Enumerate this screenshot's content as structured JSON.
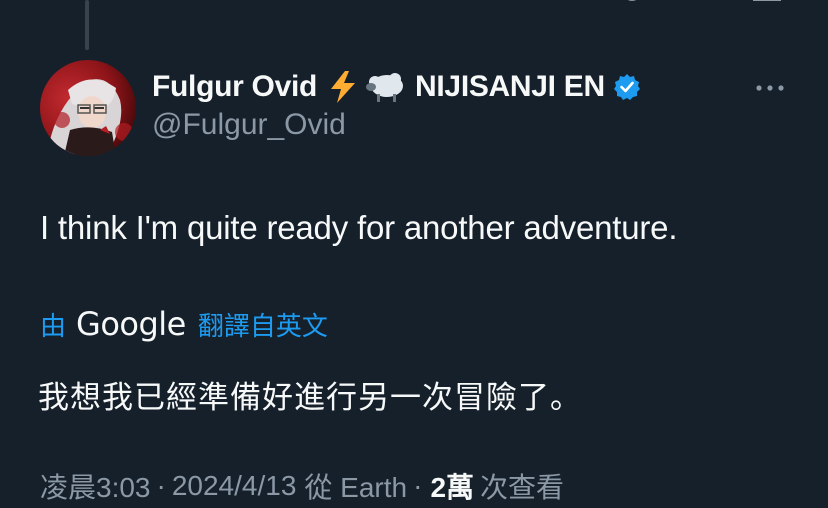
{
  "tweet": {
    "display_name": "Fulgur Ovid",
    "name_emojis": [
      "lightning-emoji",
      "sheep-emoji"
    ],
    "org": "NIJISANJI EN",
    "handle": "@Fulgur_Ovid",
    "text": "I think I'm quite ready for another adventure.",
    "translation": {
      "by_label": "由",
      "provider": "Google",
      "source_label": "翻譯自英文",
      "text": "我想我已經準備好進行另一次冒險了。"
    },
    "meta": {
      "time": "凌晨3:03",
      "separator": "·",
      "date": "2024/4/13",
      "source": "從 Earth",
      "views_count": "2萬",
      "views_label": "次查看"
    }
  },
  "colors": {
    "background": "#15202b",
    "accent": "#1d9bf0",
    "secondary_text": "#8b98a5",
    "verified": "#1d9bf0"
  },
  "icons": [
    "reply-icon",
    "retweet-icon",
    "like-icon",
    "views-icon",
    "bookmark-icon",
    "share-icon",
    "more-options-icon",
    "verified-badge-icon"
  ]
}
